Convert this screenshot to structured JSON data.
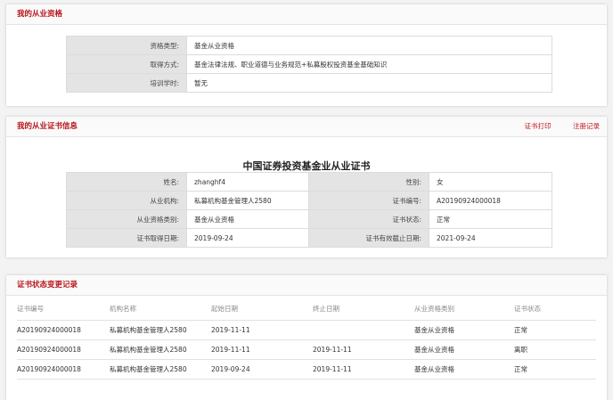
{
  "qualification": {
    "title": "我的从业资格",
    "rows": [
      {
        "label": "资格类型:",
        "value": "基金从业资格"
      },
      {
        "label": "取得方式:",
        "value": "基金法律法规、职业道德与业务规范+私募股权投资基金基础知识"
      },
      {
        "label": "培训学时:",
        "value": "暂无"
      }
    ]
  },
  "certificate": {
    "title": "我的从业证书信息",
    "links": {
      "print": "证书打印",
      "registration": "注册记录"
    },
    "cert_name": "中国证券投资基金业从业证书",
    "rows": [
      {
        "l1": "姓名:",
        "v1": "zhanghf4",
        "l2": "性别:",
        "v2": "女"
      },
      {
        "l1": "从业机构:",
        "v1": "私募机构基金管理人2580",
        "l2": "证书编号:",
        "v2": "A20190924000018"
      },
      {
        "l1": "从业资格类别:",
        "v1": "基金从业资格",
        "l2": "证书状态:",
        "v2": "正常"
      },
      {
        "l1": "证书取得日期:",
        "v1": "2019-09-24",
        "l2": "证书有效截止日期:",
        "v2": "2021-09-24"
      }
    ]
  },
  "history": {
    "title": "证书状态变更记录",
    "columns": [
      "证书编号",
      "机构名称",
      "起始日期",
      "终止日期",
      "从业资格类别",
      "证书状态"
    ],
    "rows": [
      [
        "A20190924000018",
        "私募机构基金管理人2580",
        "2019-11-11",
        "",
        "基金从业资格",
        "正常"
      ],
      [
        "A20190924000018",
        "私募机构基金管理人2580",
        "2019-11-11",
        "2019-11-11",
        "基金从业资格",
        "离职"
      ],
      [
        "A20190924000018",
        "私募机构基金管理人2580",
        "2019-09-24",
        "2019-11-11",
        "基金从业资格",
        "正常"
      ]
    ]
  }
}
